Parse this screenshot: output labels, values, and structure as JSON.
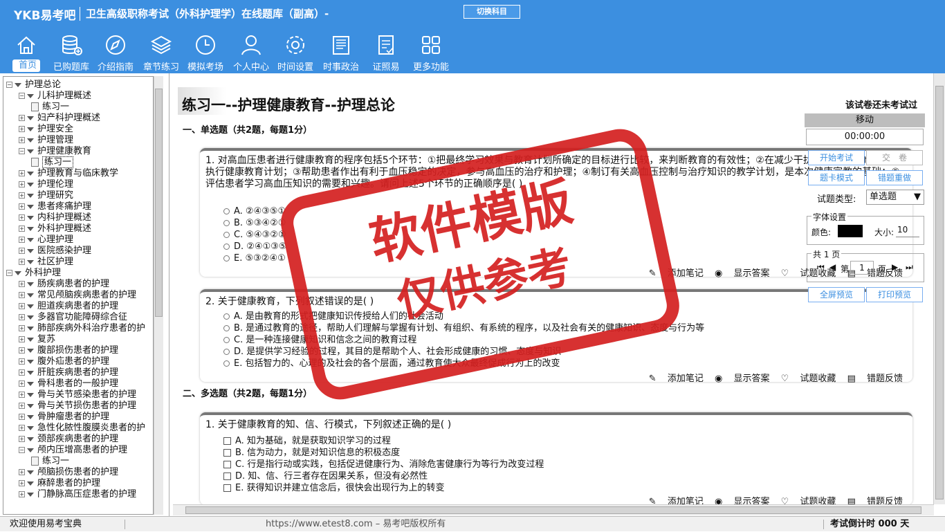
{
  "header": {
    "logo": "YKB易考吧",
    "title": "卫生高级职称考试（外科护理学）在线题库（副高）-",
    "switch_label": "切换科目"
  },
  "nav": [
    "首页",
    "已购题库",
    "介绍指南",
    "章节练习",
    "模拟考场",
    "个人中心",
    "时间设置",
    "时事政治",
    "证照易",
    "更多功能"
  ],
  "tree": {
    "rows": [
      {
        "label": "护理总论",
        "level": 0,
        "pm": "−",
        "tri": true
      },
      {
        "label": "儿科护理概述",
        "level": 1,
        "pm": "−",
        "tri": true
      },
      {
        "label": "练习一",
        "level": 2,
        "doc": true
      },
      {
        "label": "妇产科护理概述",
        "level": 1,
        "pm": "+",
        "tri": true
      },
      {
        "label": "护理安全",
        "level": 1,
        "pm": "+",
        "tri": true
      },
      {
        "label": "护理管理",
        "level": 1,
        "pm": "+",
        "tri": true
      },
      {
        "label": "护理健康教育",
        "level": 1,
        "pm": "−",
        "tri": true
      },
      {
        "label": "练习一",
        "level": 2,
        "doc": true,
        "sel": true
      },
      {
        "label": "护理教育与临床教学",
        "level": 1,
        "pm": "+",
        "tri": true
      },
      {
        "label": "护理伦理",
        "level": 1,
        "pm": "+",
        "tri": true
      },
      {
        "label": "护理研究",
        "level": 1,
        "pm": "+",
        "tri": true
      },
      {
        "label": "患者疼痛护理",
        "level": 1,
        "pm": "+",
        "tri": true
      },
      {
        "label": "内科护理概述",
        "level": 1,
        "pm": "+",
        "tri": true
      },
      {
        "label": "外科护理概述",
        "level": 1,
        "pm": "+",
        "tri": true
      },
      {
        "label": "心理护理",
        "level": 1,
        "pm": "+",
        "tri": true
      },
      {
        "label": "医院感染护理",
        "level": 1,
        "pm": "+",
        "tri": true
      },
      {
        "label": "社区护理",
        "level": 1,
        "pm": "+",
        "tri": true
      },
      {
        "label": "外科护理",
        "level": 0,
        "pm": "−",
        "tri": true
      },
      {
        "label": "肠疾病患者的护理",
        "level": 1,
        "pm": "+",
        "tri": true
      },
      {
        "label": "常见颅脑疾病患者的护理",
        "level": 1,
        "pm": "+",
        "tri": true
      },
      {
        "label": "胆道疾病患者的护理",
        "level": 1,
        "pm": "+",
        "tri": true
      },
      {
        "label": "多器官功能障碍综合征",
        "level": 1,
        "pm": "+",
        "tri": true
      },
      {
        "label": "肺部疾病外科治疗患者的护",
        "level": 1,
        "pm": "+",
        "tri": true
      },
      {
        "label": "复苏",
        "level": 1,
        "pm": "+",
        "tri": true
      },
      {
        "label": "腹部损伤患者的护理",
        "level": 1,
        "pm": "+",
        "tri": true
      },
      {
        "label": "腹外疝患者的护理",
        "level": 1,
        "pm": "+",
        "tri": true
      },
      {
        "label": "肝脏疾病患者的护理",
        "level": 1,
        "pm": "+",
        "tri": true
      },
      {
        "label": "骨科患者的一般护理",
        "level": 1,
        "pm": "+",
        "tri": true
      },
      {
        "label": "骨与关节感染患者的护理",
        "level": 1,
        "pm": "+",
        "tri": true
      },
      {
        "label": "骨与关节损伤患者的护理",
        "level": 1,
        "pm": "+",
        "tri": true
      },
      {
        "label": "骨肿瘤患者的护理",
        "level": 1,
        "pm": "+",
        "tri": true
      },
      {
        "label": "急性化脓性腹膜炎患者的护",
        "level": 1,
        "pm": "+",
        "tri": true
      },
      {
        "label": "颈部疾病患者的护理",
        "level": 1,
        "pm": "+",
        "tri": true
      },
      {
        "label": "颅内压增高患者的护理",
        "level": 1,
        "pm": "−",
        "tri": true
      },
      {
        "label": "练习一",
        "level": 2,
        "doc": true
      },
      {
        "label": "颅脑损伤患者的护理",
        "level": 1,
        "pm": "+",
        "tri": true
      },
      {
        "label": "麻醉患者的护理",
        "level": 1,
        "pm": "+",
        "tri": true
      },
      {
        "label": "门静脉高压症患者的护理",
        "level": 1,
        "pm": "+",
        "tri": true
      }
    ]
  },
  "paper": {
    "title": "练习一--护理健康教育--护理总论",
    "status": "该试卷还未考试过"
  },
  "sections": [
    "一、单选题（共2题，每题1分）",
    "二、多选题（共2题，每题1分）"
  ],
  "q1": {
    "text": "1. 对高血压患者进行健康教育的程序包括5个环节：①把最终学习效果与教育计划所确定的目标进行比较，来判断教育的有效性；②在减少干扰、确保隐私的前提下执行健康教育计划；③帮助患者作出有利于血压稳定的决定，参与高血压的治疗和护理；④制订有关高血压控制与治疗知识的教学计划，是本次健康宣教的基础；⑤评估患者学习高血压知识的需要和兴趣。请问上述5个环节的正确顺序是( )",
    "options": [
      "A. ②④③⑤①",
      "B. ⑤③④②①",
      "C. ⑤④③②①",
      "D. ②④①③⑤",
      "E. ⑤③②④①"
    ]
  },
  "q2": {
    "text": "2. 关于健康教育，下列叙述错误的是( )",
    "options": [
      "A. 是由教育的形式把健康知识传授给人们的社会活动",
      "B. 是通过教育的途径，帮助人们理解与掌握有计划、有组织、有系统的程序，以及社会有关的健康知识、态度与行为等",
      "C. 是一种连接健康知识和信念之间的教育过程",
      "D. 是提供学习经验的过程，其目的是帮助个人、社会形成健康的习惯、态度与知识",
      "E. 包括智力的、心理的及社会的各个层面，通过教育使大众最终促成行为上的改变"
    ]
  },
  "q3": {
    "text": "1. 关于健康教育的知、信、行模式，下列叙述正确的是( )",
    "options": [
      "A. 知为基础，就是获取知识学习的过程",
      "B. 信为动力，就是对知识信息的积极态度",
      "C. 行是指行动或实践，包括促进健康行为、消除危害健康行为等行为改变过程",
      "D. 知、信、行三者存在因果关系，但没有必然性",
      "E. 获得知识并建立信念后，很快会出现行为上的转变"
    ]
  },
  "actions": {
    "note": "添加笔记",
    "answer": "显示答案",
    "fav": "试题收藏",
    "report": "错题反馈"
  },
  "panel": {
    "move": "移动",
    "timer": "00:00:00",
    "start": "开始考试",
    "submit": "交　卷",
    "card": "题卡模式",
    "reset": "错题重做",
    "type_label": "试题类型:",
    "type_value": "单选题",
    "font_legend": "字体设置",
    "color_label": "颜色:",
    "size_label": "大小:",
    "size_value": "10",
    "page_legend": "共 1 页",
    "page_prefix": "第",
    "page_value": "1",
    "page_suffix": "页",
    "fullscreen": "全屏预览",
    "print": "打印预览"
  },
  "status": {
    "welcome": "欢迎使用易考宝典",
    "copyright": "https://www.etest8.com – 易考吧版权所有",
    "countdown": "考试倒计时 000 天"
  },
  "watermark": {
    "line1": "软件模版",
    "line2": "仅供参考"
  }
}
